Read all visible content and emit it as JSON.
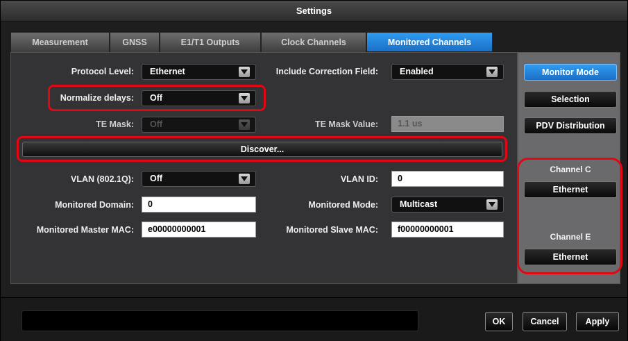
{
  "window": {
    "title": "Settings"
  },
  "tabs": [
    {
      "label": "Measurement"
    },
    {
      "label": "GNSS"
    },
    {
      "label": "E1/T1 Outputs"
    },
    {
      "label": "Clock Channels"
    },
    {
      "label": "Monitored Channels"
    }
  ],
  "form": {
    "protocol_level": {
      "label": "Protocol Level:",
      "value": "Ethernet"
    },
    "include_correction": {
      "label": "Include Correction Field:",
      "value": "Enabled"
    },
    "normalize_delays": {
      "label": "Normalize delays:",
      "value": "Off"
    },
    "te_mask": {
      "label": "TE Mask:",
      "value": "Off"
    },
    "te_mask_value": {
      "label": "TE Mask Value:",
      "value": "1.1 us"
    },
    "discover_label": "Discover...",
    "vlan": {
      "label": "VLAN (802.1Q):",
      "value": "Off"
    },
    "vlan_id": {
      "label": "VLAN ID:",
      "value": "0"
    },
    "monitored_domain": {
      "label": "Monitored Domain:",
      "value": "0"
    },
    "monitored_mode": {
      "label": "Monitored Mode:",
      "value": "Multicast"
    },
    "master_mac": {
      "label": "Monitored Master MAC:",
      "value": "e00000000001"
    },
    "slave_mac": {
      "label": "Monitored Slave MAC:",
      "value": "f00000000001"
    }
  },
  "side": {
    "monitor_mode": "Monitor Mode",
    "selection": "Selection",
    "pdv_distribution": "PDV Distribution",
    "channel_c": {
      "label": "Channel C",
      "button": "Ethernet"
    },
    "channel_e": {
      "label": "Channel E",
      "button": "Ethernet"
    }
  },
  "footer": {
    "ok": "OK",
    "cancel": "Cancel",
    "apply": "Apply"
  },
  "colors": {
    "accent": "#2f9cf0",
    "highlight": "#e30613"
  }
}
